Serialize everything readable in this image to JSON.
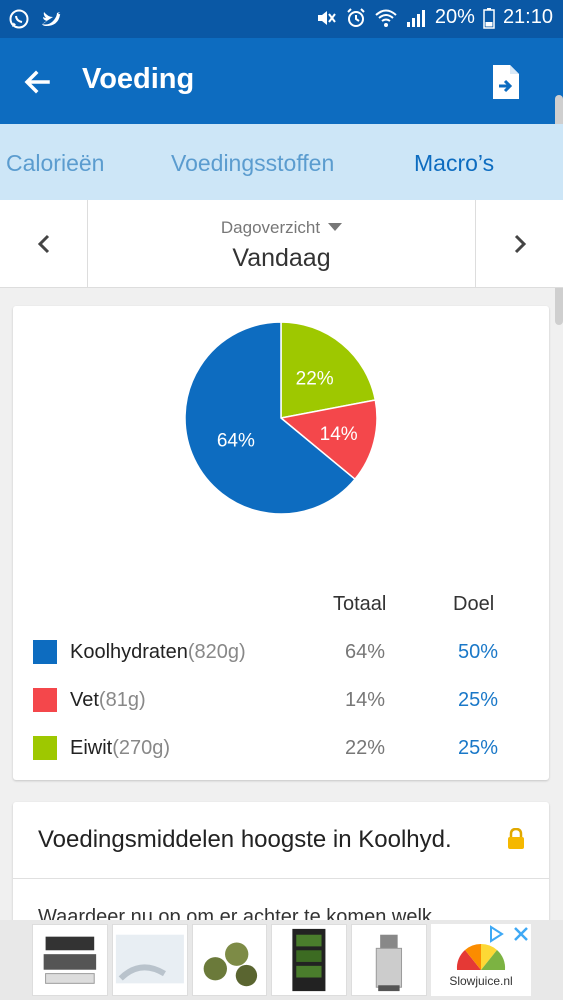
{
  "status_bar": {
    "battery": "20%",
    "time": "21:10",
    "icons": [
      "whatsapp-icon",
      "twitter-icon",
      "mute-icon",
      "alarm-icon",
      "wifi-icon",
      "signal-icon",
      "battery-icon"
    ]
  },
  "app_bar": {
    "title": "Voeding",
    "back_icon": "arrow-back-icon",
    "export_icon": "file-export-icon"
  },
  "tabs": [
    {
      "label": "Calorieën",
      "active": false
    },
    {
      "label": "Voedingsstoffen",
      "active": false
    },
    {
      "label": "Macro’s",
      "active": true
    }
  ],
  "date_nav": {
    "period_label": "Dagoverzicht",
    "day_label": "Vandaag"
  },
  "macros": {
    "header_total": "Totaal",
    "header_goal": "Doel",
    "rows": [
      {
        "name": "Koolhydraten",
        "grams": "(820g)",
        "total": "64%",
        "goal": "50%",
        "color": "#0d6cc0"
      },
      {
        "name": "Vet",
        "grams": "(81g)",
        "total": "14%",
        "goal": "25%",
        "color": "#f4474b"
      },
      {
        "name": "Eiwit",
        "grams": "(270g)",
        "total": "22%",
        "goal": "25%",
        "color": "#9ec800"
      }
    ]
  },
  "chart_data": {
    "type": "pie",
    "labels": [
      "Koolhydraten",
      "Vet",
      "Eiwit"
    ],
    "values": [
      64,
      14,
      22
    ],
    "value_labels": [
      "64%",
      "14%",
      "22%"
    ],
    "colors": [
      "#0d6cc0",
      "#f4474b",
      "#9ec800"
    ]
  },
  "foods_card": {
    "heading": "Voedingsmiddelen hoogste in Koolhyd.",
    "teaser": "Waardeer nu op om er achter te komen welk"
  },
  "ad": {
    "brand_text": "Slowjuice.nl"
  }
}
